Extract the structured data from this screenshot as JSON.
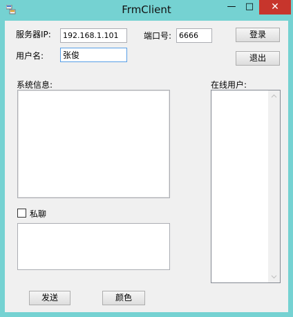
{
  "window": {
    "title": "FrmClient",
    "minimize_glyph": "—",
    "maximize_glyph": "□",
    "close_glyph": "✕",
    "accent_color": "#75d2d2",
    "close_color": "#c7352c"
  },
  "connection": {
    "server_ip_label": "服务器IP:",
    "server_ip_value": "192.168.1.101",
    "port_label": "端口号:",
    "port_value": "6666",
    "username_label": "用户名:",
    "username_value": "张俊"
  },
  "buttons": {
    "login": "登录",
    "exit": "退出",
    "send": "发送",
    "color": "颜色"
  },
  "system_info": {
    "label": "系统信息:"
  },
  "online_users": {
    "label": "在线用户:",
    "items": []
  },
  "private_chat": {
    "label": "私聊",
    "checked": false
  },
  "message": {
    "value": ""
  }
}
